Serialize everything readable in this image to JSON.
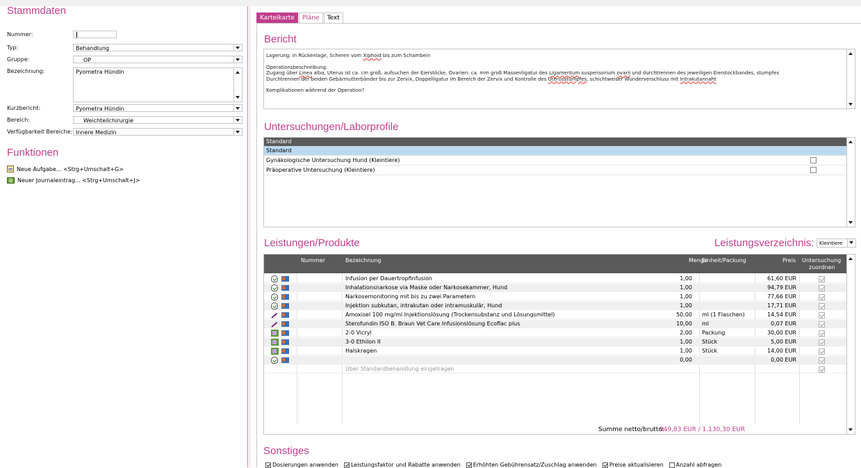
{
  "left": {
    "stammdaten_title": "Stammdaten",
    "fields": {
      "nummer": {
        "label": "Nummer:",
        "value": ""
      },
      "typ": {
        "label": "Typ:",
        "value": "Behandlung"
      },
      "gruppe": {
        "label": "Gruppe:",
        "value": "OP"
      },
      "bezeichnung": {
        "label": "Bezeichnung:",
        "value": "Pyometra Hündin"
      },
      "kurzbericht": {
        "label": "Kurzbericht:",
        "value": "Pyometra Hündin"
      },
      "bereich": {
        "label": "Bereich:",
        "value": "Weichteilchirurgie"
      },
      "verfuegbarkeit": {
        "label": "Verfügbarkeit Bereiche:",
        "value": "Innere Medizin"
      }
    },
    "funktionen_title": "Funktionen",
    "funktionen": [
      {
        "label": "Neue Aufgabe... <Strg+Umschalt+G>",
        "icon": "task-icon"
      },
      {
        "label": "Neuer Journaleintrag... <Strg+Umschalt+J>",
        "icon": "journal-icon"
      }
    ]
  },
  "tabs": [
    "Karteikarte",
    "Pläne",
    "Text"
  ],
  "bericht": {
    "title": "Bericht",
    "line1_a": "Lagerung: in Rückenlage, Scheren vom ",
    "line1_u": "Xiphoid",
    "line1_b": " bis zum Schambein",
    "ops_header": "Operationsbeschreibung:",
    "ops_1a": "Zugang über ",
    "ops_1u1": "Linea",
    "ops_1b": " alba, Uterus ist ca. cm groß, aufsuchen der Eierstöcke, Ovarien: ca. mm groß Massenligatur des ",
    "ops_1u2": "Ligamentum",
    "ops_1c": " suspensorium ",
    "ops_1u3": "ovarii",
    "ops_1d": " und durchtrennen des jeweiligen Eierstockbandes, stumpfes",
    "ops_2a": "Durchtrennen der beiden Gebärmutterbänder bis zur Zervix, Doppelligatur im Bereich der Zervix und  Kontrolle des ",
    "ops_2u1": "Uterusstumpfes",
    "ops_2b": ", schichtweiser Wunderverschluss mit ",
    "ops_2u2": "Intrakutannaht",
    "komplikationen": "Komplikationen während der Operation?"
  },
  "untersuchungen": {
    "title": "Untersuchungen/Laborprofile",
    "header": "Standard",
    "rows": [
      {
        "label": "Standard",
        "selected": true,
        "checkbox": false
      },
      {
        "label": "Gynäkologische Untersuchung Hund (Kleintiere)",
        "selected": false,
        "checkbox": true
      },
      {
        "label": "Präoperative Untersuchung (Kleintiere)",
        "selected": false,
        "checkbox": true
      }
    ]
  },
  "leistungen": {
    "title": "Leistungen/Produkte",
    "verzeichnis_label": "Leistungsverzeichnis:",
    "verzeichnis_value": "Kleintiere",
    "headers": {
      "nummer": "Nummer",
      "bezeichnung": "Bezeichnung",
      "menge": "Menge",
      "einheit": "Einheit/Packung",
      "preis": "Preis",
      "untersuchung_1": "Untersuchung",
      "untersuchung_2": "zuordnen"
    },
    "rows": [
      {
        "icon": "treatment",
        "bezeichnung": "Infusion per Dauertropfinfusion",
        "menge": "1,00",
        "einheit": "",
        "preis": "61,60 EUR"
      },
      {
        "icon": "treatment",
        "bezeichnung": "Inhalationsnarkose via Maske oder Narkosekammer, Hund",
        "menge": "1,00",
        "einheit": "",
        "preis": "94,79 EUR"
      },
      {
        "icon": "treatment",
        "bezeichnung": "Narkosemonitoring mit bis zu zwei Parametern",
        "menge": "1,00",
        "einheit": "",
        "preis": "77,66 EUR"
      },
      {
        "icon": "treatment",
        "bezeichnung": "Injektion subkutan, intrakutan oder intramuskulär, Hund",
        "menge": "1,00",
        "einheit": "",
        "preis": "17,71 EUR"
      },
      {
        "icon": "drug",
        "bezeichnung": "Amoxisel 100 mg/ml Injektionslösung (Trockensubstanz und Lösungsmittel)",
        "menge": "50,00",
        "einheit": "ml (1 Flaschen)",
        "preis": "14,54 EUR"
      },
      {
        "icon": "drug",
        "bezeichnung": "Sterofundin ISO B. Braun Vet Care Infusionslösung Ecoflac plus",
        "menge": "10,00",
        "einheit": "ml",
        "preis": "0,07 EUR"
      },
      {
        "icon": "product",
        "bezeichnung": "2-0 Vicryl",
        "menge": "2,00",
        "einheit": "Packung",
        "preis": "30,00 EUR"
      },
      {
        "icon": "product",
        "bezeichnung": "3-0 Ethilon II",
        "menge": "1,00",
        "einheit": "Stück",
        "preis": "5,00 EUR"
      },
      {
        "icon": "product",
        "bezeichnung": "Halskragen",
        "menge": "1,00",
        "einheit": "Stück",
        "preis": "14,00 EUR"
      },
      {
        "icon": "treatment",
        "bezeichnung": "",
        "menge": "0,00",
        "einheit": "",
        "preis": "0,00 EUR"
      },
      {
        "icon": "",
        "bezeichnung": "Über Standardbehandlung eingetragen",
        "menge": "",
        "einheit": "",
        "preis": ""
      }
    ],
    "summe_label": "Summe netto/brutto:",
    "summe_value": "949,83 EUR / 1.130,30 EUR"
  },
  "sonstiges": {
    "title": "Sonstiges",
    "options": [
      {
        "label": "Dosierungen anwenden",
        "checked": true
      },
      {
        "label": "Leistungsfaktor und Rabatte anwenden",
        "checked": true
      },
      {
        "label": "Erhöhten Gebührensatz/Zuschlag anwenden",
        "checked": true
      },
      {
        "label": "Preise aktualisieren",
        "checked": true
      },
      {
        "label": "Anzahl abfragen",
        "checked": false
      }
    ]
  },
  "colors": {
    "accent": "#c03e8c",
    "header_bg": "#5a5a5a",
    "selection": "#bcd9f0"
  }
}
